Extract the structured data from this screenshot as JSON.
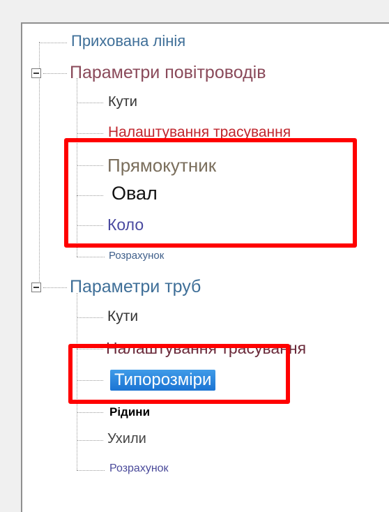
{
  "tree": {
    "hidden_line": "Прихована лінія",
    "ducts": {
      "label": "Параметри повітроводів",
      "children": {
        "angles": "Кути",
        "routing": "Налаштування трасування",
        "rectangle": "Прямокутник",
        "oval": "Овал",
        "circle": "Коло",
        "calculation": "Розрахунок"
      }
    },
    "pipes": {
      "label": "Параметри труб",
      "children": {
        "angles": "Кути",
        "routing": "Налаштування трасування",
        "sizes": "Типорозміри",
        "fluids": "Рідини",
        "slopes": "Ухили",
        "calculation": "Розрахунок"
      }
    }
  },
  "colors": {
    "highlight_box": "#ff0000",
    "selection": "#1b74d3"
  }
}
